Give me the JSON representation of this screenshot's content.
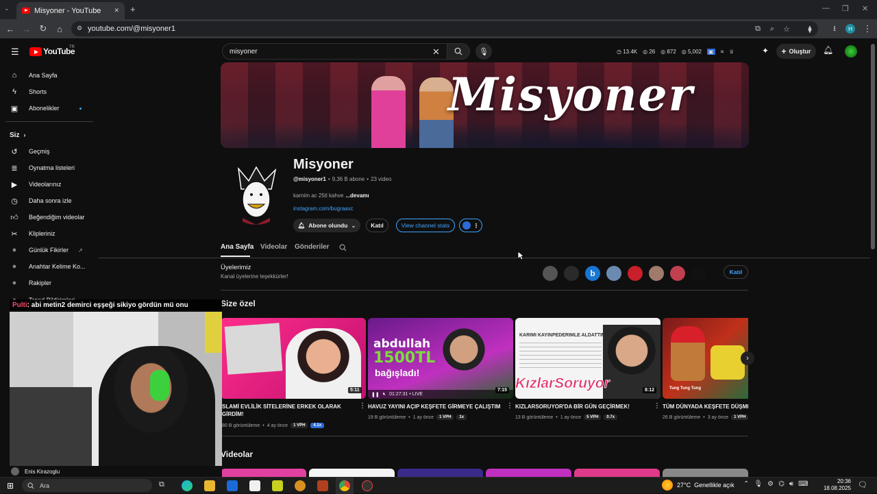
{
  "browser": {
    "tab_title": "Misyoner - YouTube",
    "new_tab": "+",
    "close_tab": "✕",
    "url": "youtube.com/@misyoner1",
    "profile_initial": "H"
  },
  "header": {
    "logo_text": "YouTube",
    "logo_country": "TR",
    "search_value": "misyoner",
    "stats": [
      "13.4K",
      "26",
      "872",
      "5,002"
    ],
    "create_label": "Oluştur"
  },
  "sidebar": {
    "items": [
      {
        "label": "Ana Sayfa",
        "icon": "home-icon"
      },
      {
        "label": "Shorts",
        "icon": "shorts-icon"
      },
      {
        "label": "Abonelikler",
        "icon": "subscriptions-icon"
      }
    ],
    "you_header": "Siz",
    "you_items": [
      {
        "label": "Geçmiş",
        "icon": "history-icon"
      },
      {
        "label": "Oynatma listeleri",
        "icon": "playlist-icon"
      },
      {
        "label": "Videolarınız",
        "icon": "your-videos-icon"
      },
      {
        "label": "Daha sonra izle",
        "icon": "watch-later-icon"
      },
      {
        "label": "Beğendiğim videolar",
        "icon": "like-icon"
      },
      {
        "label": "Klipleriniz",
        "icon": "clips-icon"
      },
      {
        "label": "Günlük Fikirler",
        "icon": "app-icon"
      },
      {
        "label": "Anahtar Kelime Ko...",
        "icon": "app-icon"
      },
      {
        "label": "Rakipler",
        "icon": "app-icon"
      },
      {
        "label": "Trend Bildirimleri",
        "icon": "app-icon"
      }
    ]
  },
  "channel": {
    "name": "Misyoner",
    "handle": "@misyoner1",
    "subscribers": "9,36 B abone",
    "video_count": "23 video",
    "description": "karnim ac 25tl kahve",
    "more_label": "...devamı",
    "link": "instagram.com/bugraaxc",
    "subscribed_label": "Abone olundu",
    "join_label": "Katıl",
    "stats_label": "View channel stats"
  },
  "tabs": [
    "Ana Sayfa",
    "Videolar",
    "Gönderiler"
  ],
  "members": {
    "title": "Üyelerimiz",
    "subtitle": "Kanal üyelerine teşekkürler!",
    "join_label": "Katıl",
    "avatar_letter": "b"
  },
  "for_you": {
    "title": "Size özel",
    "videos": [
      {
        "title_line1": "SLAMİ EVLİLİK SİTELERİNE ERKEK OLARAK",
        "title_line2": "GİRDİM!",
        "views": "80 B görüntüleme",
        "age": "4 ay önce",
        "vph": "1 VPH",
        "ratio": "4.1x",
        "duration": "5:11"
      },
      {
        "title_line1": "HAVUZ YAYINI AÇIP KEŞFETE GİRMEYE ÇALIŞTIM",
        "title_line2": "",
        "views": "19 B görüntüleme",
        "age": "1 ay önce",
        "vph": "1 VPH",
        "ratio": "1x",
        "duration": "7:15",
        "live_time": "01:27:31 • LIVE"
      },
      {
        "title_line1": "KIZLARSORUYOR'DA BİR GÜN GEÇİRMEK!",
        "title_line2": "",
        "views": "13 B görüntüleme",
        "age": "1 ay önce",
        "vph": "5 VPH",
        "ratio": "0.7x",
        "duration": "8:12"
      },
      {
        "title_line1": "TÜM DÜNYADA KEŞFETE DÜŞME",
        "title_line2": "",
        "views": "26 B görüntüleme",
        "age": "3 ay önce",
        "vph": "1 VPH",
        "ratio": "",
        "duration": ""
      }
    ],
    "thumb_texts": {
      "abdullah": "abdullah",
      "amount": "1500TL",
      "donated": "bağışladı!",
      "cheat_title": "KARIMI KAYINPEDERIMLE ALDATTIM",
      "kizlar": "KızlarSoruyor",
      "tiktok": "Tung Tung Tung"
    }
  },
  "videos_section": {
    "title": "Videolar"
  },
  "overlay": {
    "chat_user": "Pulti",
    "chat_message": ": abi metin2 demirci eşşeği sikiyo gördün mü onu",
    "streamer_name": "Enis Kirazoglu"
  },
  "taskbar": {
    "search_placeholder": "Ara",
    "weather": "27°C",
    "weather_desc": "Genellikle açık",
    "time": "20:36",
    "date": "18.08.2025"
  },
  "colors": {
    "accent_red": "#ff0000",
    "accent_blue": "#3ea6ff",
    "bg": "#0f0f0f"
  }
}
